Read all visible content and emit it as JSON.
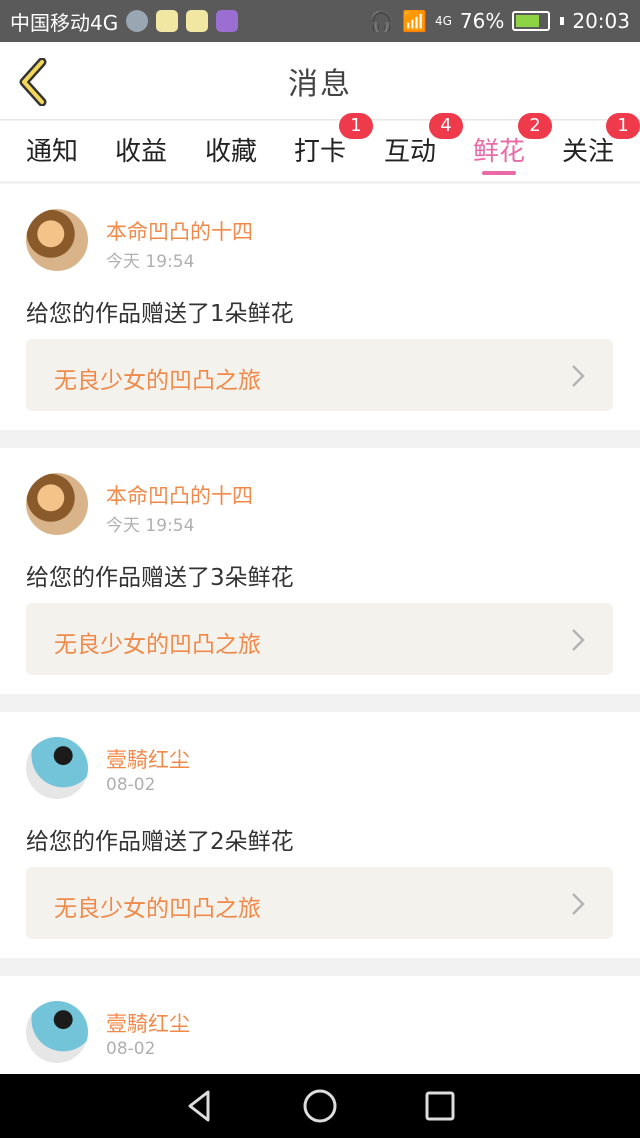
{
  "status_bar": {
    "carrier": "中国移动4G",
    "network": "4G",
    "battery_percent": "76%",
    "battery_level": 0.76,
    "time": "20:03"
  },
  "header": {
    "title": "消息"
  },
  "tabs": [
    {
      "label": "通知",
      "badge": ""
    },
    {
      "label": "收益",
      "badge": ""
    },
    {
      "label": "收藏",
      "badge": ""
    },
    {
      "label": "打卡",
      "badge": "1"
    },
    {
      "label": "互动",
      "badge": "4"
    },
    {
      "label": "鲜花",
      "badge": "2",
      "active": true
    },
    {
      "label": "关注",
      "badge": "1"
    }
  ],
  "messages": [
    {
      "user": "本命凹凸的十四",
      "time": "今天 19:54",
      "text": "给您的作品赠送了1朵鲜花",
      "work": "无良少女的凹凸之旅"
    },
    {
      "user": "本命凹凸的十四",
      "time": "今天 19:54",
      "text": "给您的作品赠送了3朵鲜花",
      "work": "无良少女的凹凸之旅"
    },
    {
      "user": "壹騎红尘",
      "time": "08-02",
      "text": "给您的作品赠送了2朵鲜花",
      "work": "无良少女的凹凸之旅"
    },
    {
      "user": "壹騎红尘",
      "time": "08-02"
    }
  ],
  "colors": {
    "accent": "#f08a4b",
    "active_tab": "#e86aa6",
    "badge": "#ee3a4a"
  },
  "icons": {
    "back": "chevron-left-icon",
    "nav": [
      "back-triangle-icon",
      "home-circle-icon",
      "recents-square-icon"
    ]
  }
}
